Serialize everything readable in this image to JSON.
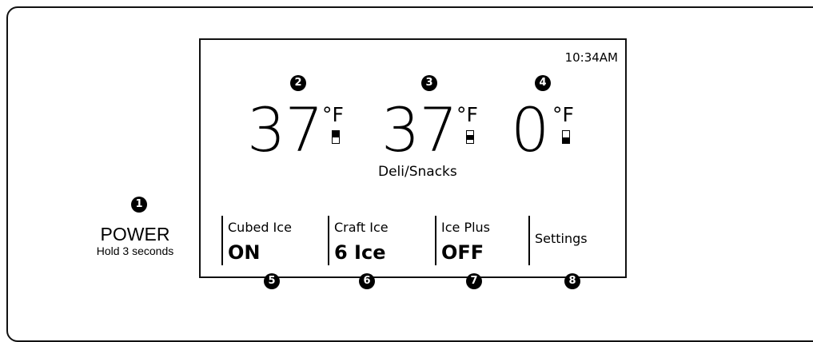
{
  "power": {
    "callout": "1",
    "label": "POWER",
    "hint": "Hold 3 seconds"
  },
  "display": {
    "clock": "10:34AM",
    "temperatures": [
      {
        "callout": "2",
        "value": "37",
        "unit": "°F",
        "level": 0.5
      },
      {
        "callout": "3",
        "value": "37",
        "unit": "°F",
        "level": 0.5
      },
      {
        "callout": "4",
        "value": "0",
        "unit": "°F",
        "level": 0.5
      }
    ],
    "compartment_label": "Deli/Snacks"
  },
  "buttons": [
    {
      "callout": "5",
      "label": "Cubed Ice",
      "value": "ON"
    },
    {
      "callout": "6",
      "label": "Craft Ice",
      "value": "6 Ice"
    },
    {
      "callout": "7",
      "label": "Ice Plus",
      "value": "OFF"
    },
    {
      "callout": "8",
      "label": "Settings",
      "value": ""
    }
  ]
}
